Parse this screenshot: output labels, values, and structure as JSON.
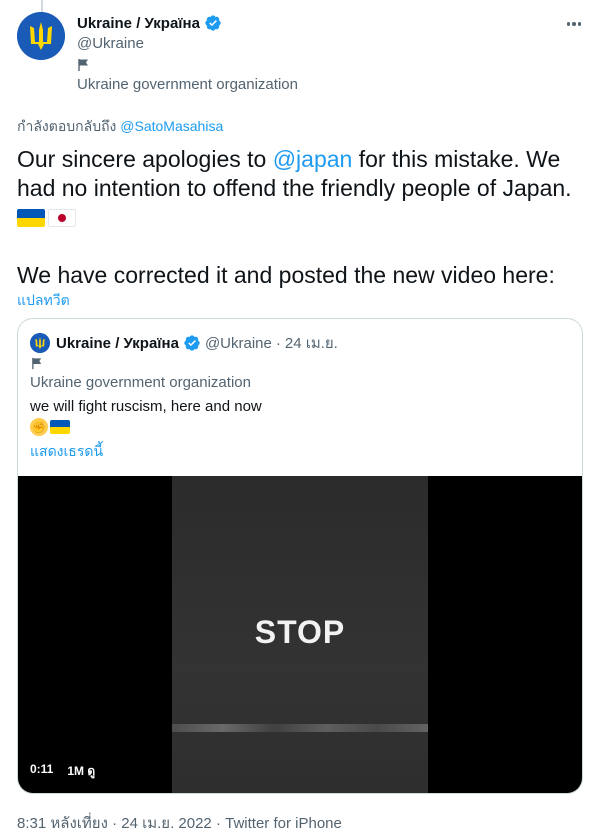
{
  "author": {
    "display_name": "Ukraine / Україна",
    "handle": "@Ukraine",
    "affiliation": "Ukraine government organization"
  },
  "reply": {
    "prefix": "กำลังตอบกลับถึง",
    "mention": "@SatoMasahisa"
  },
  "tweet": {
    "part1": "Our sincere apologies to ",
    "mention": "@japan",
    "part2": " for this mistake. We had no intention to offend the friendly people of Japan.",
    "line2": "We have corrected it and posted the new video here:"
  },
  "translate_label": "แปลทวีต",
  "quote": {
    "display_name": "Ukraine / Україна",
    "handle": "@Ukraine",
    "separator": "·",
    "date": "24 เม.ย.",
    "affiliation": "Ukraine government organization",
    "text": "we will fight ruscism, here and now",
    "show_thread": "แสดงเธรดนี้",
    "video": {
      "overlay_text": "STOP",
      "duration": "0:11",
      "views": "1M ดู"
    }
  },
  "meta": {
    "time": "8:31 หลังเที่ยง",
    "sep1": " · ",
    "date": "24 เม.ย. 2022",
    "sep2": " · ",
    "source": "Twitter for iPhone"
  },
  "colors": {
    "link": "#1d9bf0",
    "secondary": "#536471",
    "primary_text": "#0f1419",
    "ukraine_blue": "#0057b7",
    "ukraine_yellow": "#ffd700"
  }
}
